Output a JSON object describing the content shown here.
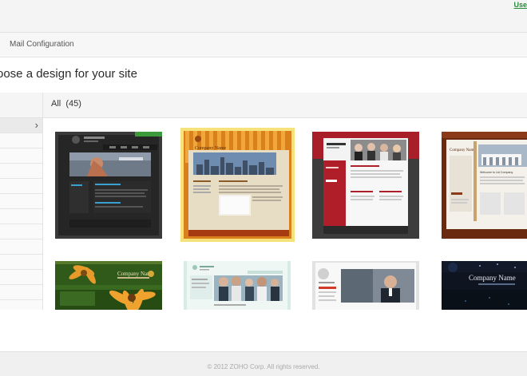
{
  "header": {
    "top_link": "Use"
  },
  "nav": {
    "mail_configuration": "Mail Configuration"
  },
  "page": {
    "heading": "oose a design for your site"
  },
  "filter": {
    "all_label": "All",
    "count": "(45)"
  },
  "templates": {
    "t2": {
      "company": "Company Name"
    },
    "t4": {
      "company": "Company Name",
      "welcome": "Welcome to Ltd Company"
    },
    "t5": {
      "company": "Company Name"
    },
    "t8": {
      "company": "Company Name"
    }
  },
  "footer": {
    "copyright": "© 2012 ZOHO Corp. All rights reserved."
  },
  "colors": {
    "selected_outline": "#f6e27a",
    "link_green": "#2a8a3a"
  }
}
